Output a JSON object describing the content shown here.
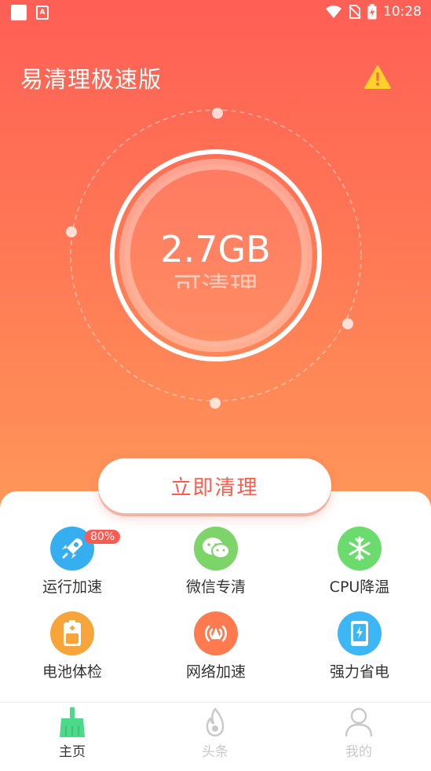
{
  "status_bar": {
    "time": "10:28",
    "notif_icon": "A"
  },
  "app": {
    "title": "易清理极速版"
  },
  "gauge": {
    "value": "2.7GB",
    "subtitle": "可清理"
  },
  "clean_button": {
    "label": "立即清理"
  },
  "features": [
    {
      "label": "运行加速",
      "icon": "rocket-icon",
      "color": "#36aff0",
      "badge": "80%"
    },
    {
      "label": "微信专清",
      "icon": "wechat-icon",
      "color": "#7dd56a"
    },
    {
      "label": "CPU降温",
      "icon": "snowflake-icon",
      "color": "#6cdb6e"
    },
    {
      "label": "电池体检",
      "icon": "battery-icon",
      "color": "#f7a53a"
    },
    {
      "label": "网络加速",
      "icon": "network-icon",
      "color": "#ff7a4f"
    },
    {
      "label": "强力省电",
      "icon": "power-save-icon",
      "color": "#3cb6f4"
    }
  ],
  "nav": [
    {
      "label": "主页",
      "icon": "broom-icon",
      "active": true
    },
    {
      "label": "头条",
      "icon": "flame-icon",
      "active": false
    },
    {
      "label": "我的",
      "icon": "user-icon",
      "active": false
    }
  ],
  "colors": {
    "accent": "#ff5a4a",
    "nav_active": "#4cd98a",
    "nav_inactive": "#c9c9c9"
  }
}
